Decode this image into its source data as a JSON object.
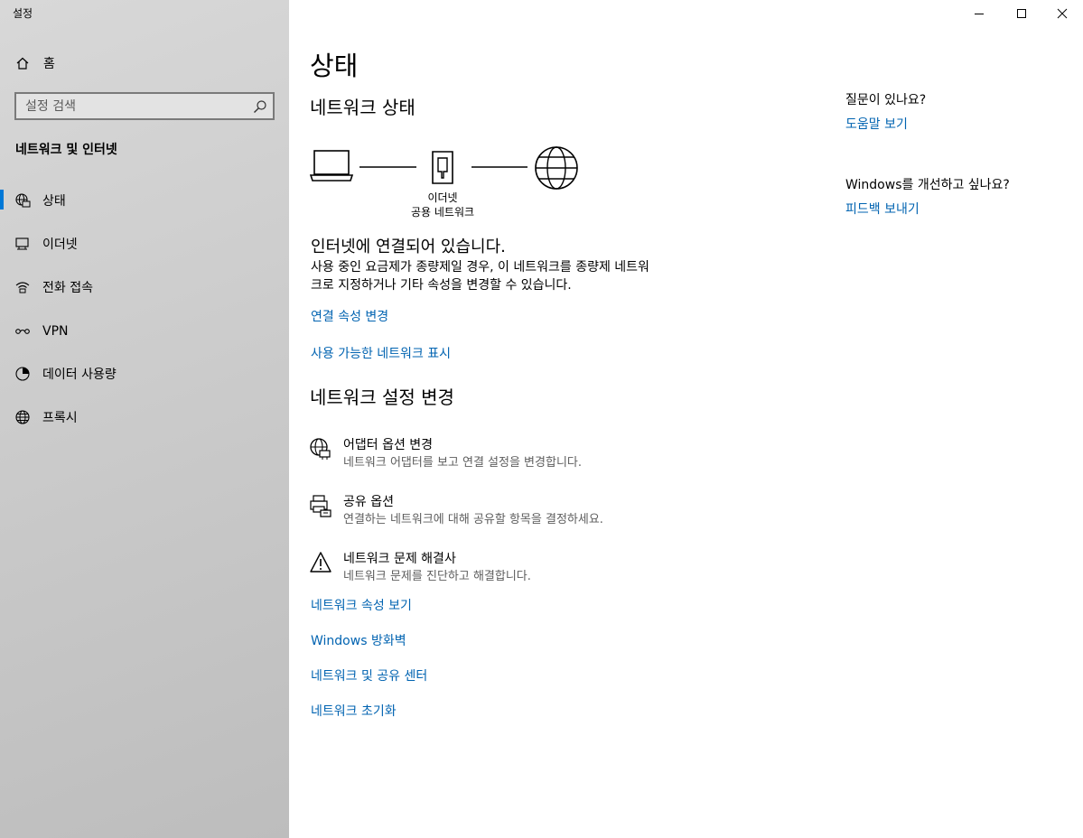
{
  "window": {
    "title": "설정",
    "minimize": "minimize",
    "maximize": "maximize",
    "close": "close"
  },
  "sidebar": {
    "home_label": "홈",
    "search_placeholder": "설정 검색",
    "section_title": "네트워크 및 인터넷",
    "items": [
      {
        "label": "상태",
        "icon": "status-globe-icon",
        "selected": true
      },
      {
        "label": "이더넷",
        "icon": "ethernet-icon",
        "selected": false
      },
      {
        "label": "전화 접속",
        "icon": "dialup-icon",
        "selected": false
      },
      {
        "label": "VPN",
        "icon": "vpn-icon",
        "selected": false
      },
      {
        "label": "데이터 사용량",
        "icon": "data-usage-icon",
        "selected": false
      },
      {
        "label": "프록시",
        "icon": "globe-icon",
        "selected": false
      }
    ],
    "accent_color": "#0078d7"
  },
  "main": {
    "page_title": "상태",
    "network_status_heading": "네트워크 상태",
    "diagram": {
      "device_label": "이더넷",
      "network_label": "공용 네트워크"
    },
    "connected_text": "인터넷에 연결되어 있습니다.",
    "description_line1": "사용 중인 요금제가 종량제일 경우, 이 네트워크를 종량제 네트워",
    "description_line2": "크로 지정하거나 기타 속성을 변경할 수 있습니다.",
    "change_connection_properties": "연결 속성 변경",
    "show_available_networks": "사용 가능한 네트워크 표시",
    "change_settings_heading": "네트워크 설정 변경",
    "options": [
      {
        "title": "어댑터 옵션 변경",
        "description": "네트워크 어댑터를 보고 연결 설정을 변경합니다.",
        "icon": "adapter-icon"
      },
      {
        "title": "공유 옵션",
        "description": "연결하는 네트워크에 대해 공유할 항목을 결정하세요.",
        "icon": "sharing-icon"
      },
      {
        "title": "네트워크 문제 해결사",
        "description": "네트워크 문제를 진단하고 해결합니다.",
        "icon": "warning-icon"
      }
    ],
    "links": {
      "view_properties": "네트워크 속성 보기",
      "firewall": "Windows 방화벽",
      "sharing_center": "네트워크 및 공유 센터",
      "reset": "네트워크 초기화"
    },
    "link_color": "#0063b1"
  },
  "aside": {
    "question": "질문이 있나요?",
    "help_link": "도움말 보기",
    "improve_question": "Windows를 개선하고 싶나요?",
    "feedback_link": "피드백 보내기"
  }
}
